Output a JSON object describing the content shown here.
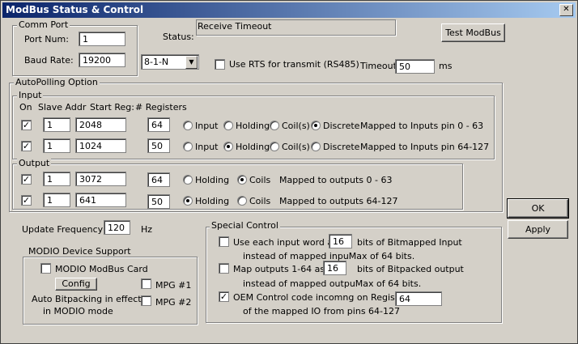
{
  "window": {
    "title": "ModBus Status & Control",
    "close_glyph": "✕"
  },
  "comm_port": {
    "group_label": "Comm Port",
    "port_label": "Port Num:",
    "port_value": "1",
    "baud_label": "Baud Rate:",
    "baud_value": "19200",
    "format_value": "8-1-N"
  },
  "status": {
    "label": "Status:",
    "value": "Receive Timeout"
  },
  "test_button": "Test ModBus",
  "rts": {
    "label": "Use RTS for transmit (RS485)",
    "checked": false
  },
  "timeout": {
    "label": "Timeout",
    "value": "50",
    "unit": "ms"
  },
  "autopolling": {
    "group_label": "AutoPolling Option",
    "input": {
      "group_label": "Input",
      "headers": {
        "on": "On",
        "slave": "Slave Addr",
        "start": "Start Reg:",
        "regs": "# Registers"
      },
      "rows": [
        {
          "on": true,
          "slave": "1",
          "start": "2048",
          "regs": "64",
          "selected": "Discrete",
          "opt_input": "Input",
          "opt_holding": "Holding",
          "opt_coils": "Coil(s)",
          "opt_discrete": "Discrete",
          "mapping": "Mapped to Inputs pin 0 - 63"
        },
        {
          "on": true,
          "slave": "1",
          "start": "1024",
          "regs": "50",
          "selected": "Holding",
          "opt_input": "Input",
          "opt_holding": "Holding",
          "opt_coils": "Coil(s)",
          "opt_discrete": "Discrete",
          "mapping": "Mapped to Inputs pin 64-127"
        }
      ]
    },
    "output": {
      "group_label": "Output",
      "rows": [
        {
          "on": true,
          "slave": "1",
          "start": "3072",
          "regs": "64",
          "selected": "Coils",
          "opt_holding": "Holding",
          "opt_coils": "Coils",
          "mapping": "Mapped to outputs 0 - 63"
        },
        {
          "on": true,
          "slave": "1",
          "start": "641",
          "regs": "50",
          "selected": "Holding",
          "opt_holding": "Holding",
          "opt_coils": "Coils",
          "mapping": "Mapped to outputs 64-127"
        }
      ]
    },
    "update": {
      "label": "Update Frequency",
      "value": "120",
      "unit": "Hz"
    }
  },
  "modio": {
    "group_label": "MODIO Device Support",
    "card_label": "MODIO ModBus Card",
    "card_checked": false,
    "config_button": "Config",
    "mpg1_label": "MPG #1",
    "mpg1_checked": false,
    "mpg2_label": "MPG #2",
    "mpg2_checked": false,
    "note_line1": "Auto Bitpacking in effect",
    "note_line2": "in MODIO mode"
  },
  "special": {
    "group_label": "Special Control",
    "bitmap_input": {
      "checked": false,
      "text_a": "Use each input word as",
      "value": "16",
      "text_b": "bits of Bitmapped Input",
      "line2": "instead of mapped inpuMax of 64 bits."
    },
    "bitpack_output": {
      "checked": false,
      "text_a": "Map outputs 1-64 as",
      "value": "16",
      "text_b": "bits of Bitpacked output",
      "line2": "instead of mapped outpuMax of 64 bits."
    },
    "oem": {
      "checked": true,
      "text_a": "OEM Control code incomng on Register #",
      "value": "64",
      "line2": "of the mapped IO from pins 64-127"
    }
  },
  "buttons": {
    "ok": "OK",
    "apply": "Apply"
  }
}
